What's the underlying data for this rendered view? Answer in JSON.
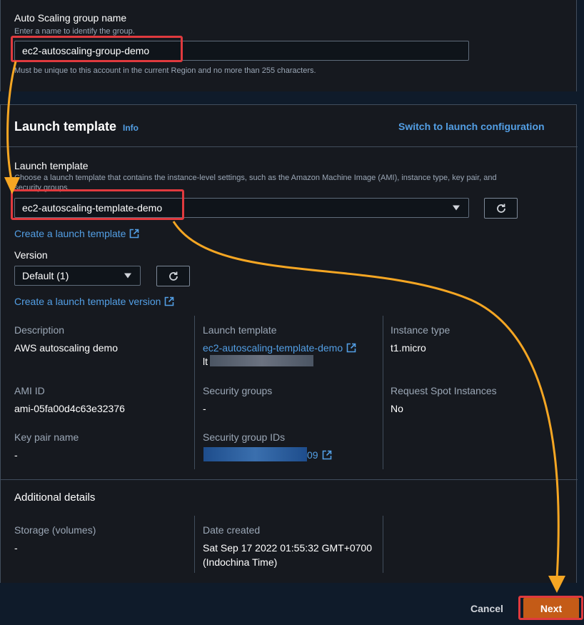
{
  "group_name": {
    "label": "Auto Scaling group name",
    "hint": "Enter a name to identify the group.",
    "value": "ec2-autoscaling-group-demo",
    "constraint": "Must be unique to this account in the current Region and no more than 255 characters."
  },
  "launch_section": {
    "title": "Launch template",
    "info": "Info",
    "switch_link": "Switch to launch configuration",
    "field_label": "Launch template",
    "field_desc_line1": "Choose a launch template that contains the instance-level settings, such as the Amazon Machine Image (AMI), instance type, key pair, and",
    "field_desc_line2": "security groups.",
    "selected": "ec2-autoscaling-template-demo",
    "create_link": "Create a launch template",
    "version_label": "Version",
    "version_selected": "Default (1)",
    "create_version_link": "Create a launch template version"
  },
  "details": {
    "description_label": "Description",
    "description_value": "AWS autoscaling demo",
    "lt_label": "Launch template",
    "lt_value": "ec2-autoscaling-template-demo",
    "lt_id_prefix": "lt",
    "instance_type_label": "Instance type",
    "instance_type_value": "t1.micro",
    "ami_label": "AMI ID",
    "ami_value": "ami-05fa00d4c63e32376",
    "sg_label": "Security groups",
    "sg_value": "-",
    "spot_label": "Request Spot Instances",
    "spot_value": "No",
    "keypair_label": "Key pair name",
    "keypair_value": "-",
    "sgid_label": "Security group IDs",
    "sgid_suffix": "09"
  },
  "additional": {
    "title": "Additional details",
    "storage_label": "Storage (volumes)",
    "storage_value": "-",
    "date_label": "Date created",
    "date_line1": "Sat Sep 17 2022 01:55:32 GMT+0700",
    "date_line2": "(Indochina Time)"
  },
  "footer": {
    "cancel": "Cancel",
    "next": "Next"
  },
  "colors": {
    "accent_link": "#539fe5",
    "primary_button": "#c45b17",
    "highlight_box": "#e03a3e",
    "annotation_arrow": "#f5a623"
  },
  "icons": {
    "refresh": "refresh-icon",
    "external": "external-link-icon",
    "caret": "caret-down-icon"
  }
}
